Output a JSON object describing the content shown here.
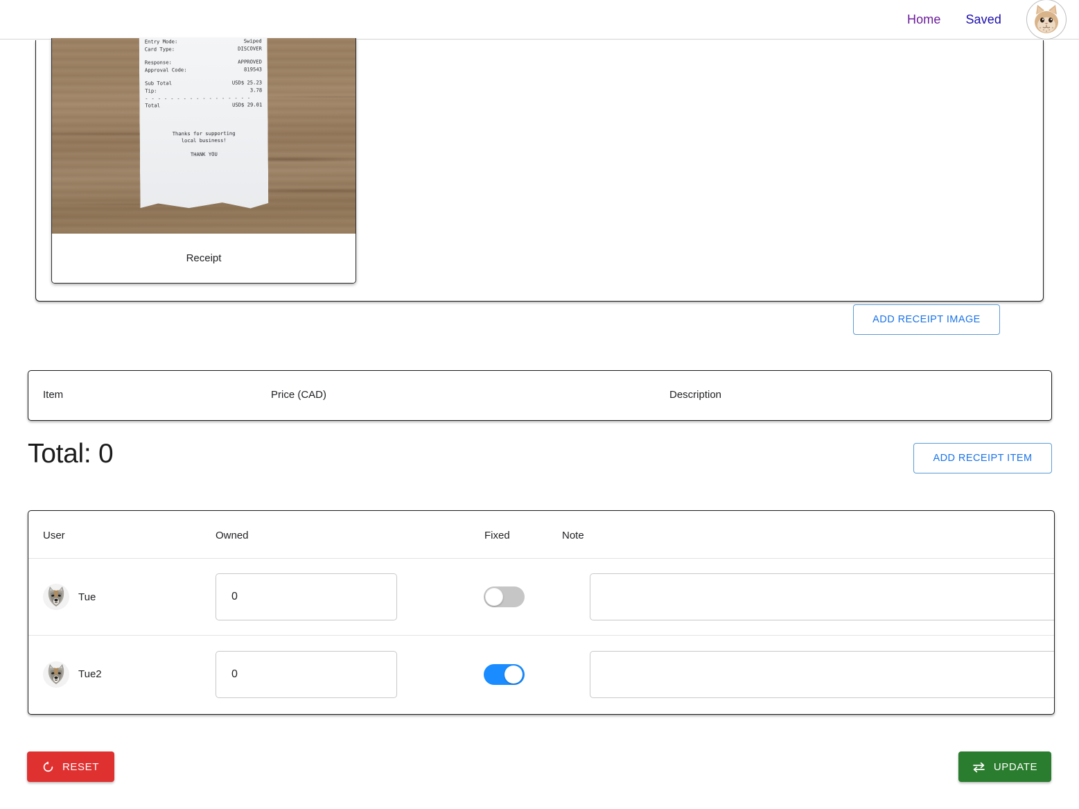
{
  "header": {
    "nav": [
      {
        "label": "Home",
        "state": "visited"
      },
      {
        "label": "Saved",
        "state": "unvisited"
      }
    ],
    "avatar_icon": "cat-avatar-icon"
  },
  "images_panel": {
    "receipt_card": {
      "caption": "Receipt",
      "photo_alt": "receipt-photo",
      "receipt_lines": {
        "entry_mode_label": "Entry Mode:",
        "entry_mode_value": "Swiped",
        "card_type_label": "Card Type:",
        "card_type_value": "DISCOVER",
        "response_label": "Response:",
        "response_value": "APPROVED",
        "approval_code_label": "Approval Code:",
        "approval_code_value": "819543",
        "sub_total_label": "Sub Total",
        "sub_total_value": "USD$ 25.23",
        "tip_label": "Tip:",
        "tip_value": "3.78",
        "divider": "- - - - - - - - - - - - - - - - -",
        "total_label": "Total",
        "total_value": "USD$ 29.01",
        "thanks_line1": "Thanks for supporting",
        "thanks_line2": "local business!",
        "thank_you": "THANK YOU"
      }
    },
    "add_receipt_image_label": "ADD RECEIPT IMAGE"
  },
  "items_table": {
    "columns": [
      "Item",
      "Price (CAD)",
      "Description"
    ],
    "rows": []
  },
  "total": {
    "label": "Total: 0"
  },
  "add_receipt_item_label": "ADD RECEIPT ITEM",
  "users_table": {
    "columns": [
      "User",
      "Owned",
      "Fixed",
      "Note"
    ],
    "rows": [
      {
        "avatar_icon": "wolf-avatar-icon",
        "name": "Tue",
        "owned": "0",
        "fixed": false,
        "note": "",
        "note_placeholder": ""
      },
      {
        "avatar_icon": "wolf-avatar-icon",
        "name": "Tue2",
        "owned": "0",
        "fixed": true,
        "note": "",
        "note_placeholder": ""
      }
    ]
  },
  "actions": {
    "reset_label": "RESET",
    "reset_icon": "refresh-icon",
    "reset_color": "#e03131",
    "update_label": "UPDATE",
    "update_icon": "swap-arrows-icon",
    "update_color": "#2a7d2e"
  },
  "colors": {
    "link_visited": "#6a1b9a",
    "link_unvisited": "#1a0dab",
    "outline_button_text": "#1a73e8",
    "toggle_on": "#1a8cff",
    "toggle_off": "#c6c6c6"
  }
}
